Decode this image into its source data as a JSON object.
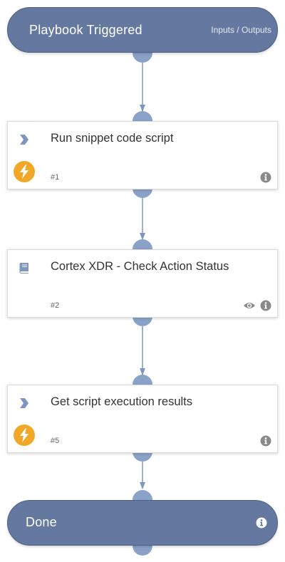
{
  "colors": {
    "node_fill": "#6478a0",
    "edge": "#7f97c0",
    "connector": "#8ba2c8",
    "bolt_badge": "#f1a829",
    "icon_gray": "#8a8a8a"
  },
  "start": {
    "title": "Playbook Triggered",
    "io_label": "Inputs / Outputs"
  },
  "tasks": [
    {
      "title": "Run snippet code script",
      "number": "#1",
      "type_icon": "chevron-icon",
      "manual": true,
      "has_eye": false
    },
    {
      "title": "Cortex XDR - Check Action Status",
      "number": "#2",
      "type_icon": "book-icon",
      "manual": false,
      "has_eye": true
    },
    {
      "title": "Get script execution results",
      "number": "#5",
      "type_icon": "chevron-icon",
      "manual": true,
      "has_eye": false
    }
  ],
  "end": {
    "title": "Done"
  }
}
